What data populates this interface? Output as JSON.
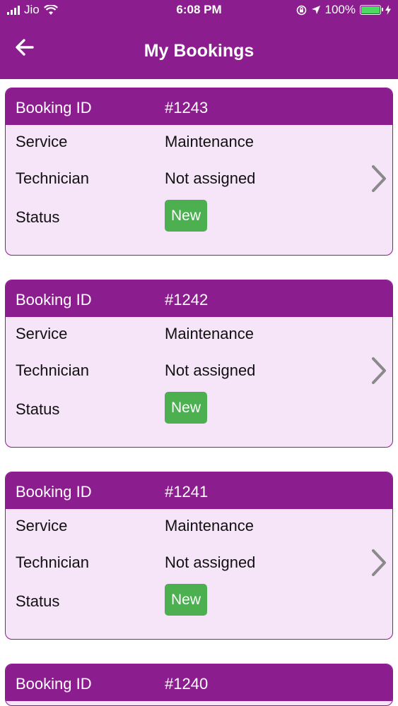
{
  "status_bar": {
    "carrier": "Jio",
    "time": "6:08 PM",
    "battery_percent": "100%"
  },
  "header": {
    "title": "My Bookings"
  },
  "bookings": [
    {
      "id_label": "Booking ID",
      "id": "#1243",
      "service_label": "Service",
      "service": "Maintenance",
      "technician_label": "Technician",
      "technician": "Not assigned",
      "status_label": "Status",
      "status": "New"
    },
    {
      "id_label": "Booking ID",
      "id": "#1242",
      "service_label": "Service",
      "service": "Maintenance",
      "technician_label": "Technician",
      "technician": "Not assigned",
      "status_label": "Status",
      "status": "New"
    },
    {
      "id_label": "Booking ID",
      "id": "#1241",
      "service_label": "Service",
      "service": "Maintenance",
      "technician_label": "Technician",
      "technician": "Not assigned",
      "status_label": "Status",
      "status": "New"
    },
    {
      "id_label": "Booking ID",
      "id": "#1240"
    }
  ],
  "colors": {
    "brand": "#8b1d8e",
    "card_bg": "#f6e4f8",
    "status_new": "#4caf50"
  },
  "icons": {
    "back": "arrow-left-icon",
    "chevron": "chevron-right-icon",
    "wifi": "wifi-icon",
    "location": "location-arrow-icon",
    "lock": "orientation-lock-icon",
    "battery": "battery-icon"
  }
}
